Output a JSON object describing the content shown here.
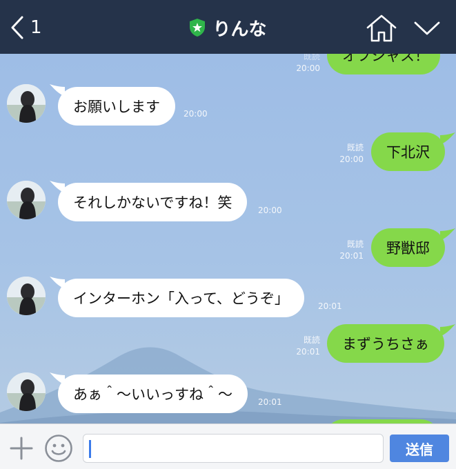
{
  "header": {
    "back_count": "1",
    "title": "りんな"
  },
  "messages": [
    {
      "dir": "out",
      "text": "オフシャス！",
      "read": "既読",
      "time": "20:00"
    },
    {
      "dir": "in",
      "text": "お願いします",
      "time": "20:00"
    },
    {
      "dir": "out",
      "text": "下北沢",
      "read": "既読",
      "time": "20:00"
    },
    {
      "dir": "in",
      "text": "それしかないですね！笑",
      "time": "20:00"
    },
    {
      "dir": "out",
      "text": "野獣邸",
      "read": "既読",
      "time": "20:01"
    },
    {
      "dir": "in",
      "text": "インターホン「入って、どうぞ」",
      "time": "20:01"
    },
    {
      "dir": "out",
      "text": "まずうちさぁ",
      "read": "既読",
      "time": "20:01"
    },
    {
      "dir": "in",
      "text": "あぁ＾〜いいっすね＾〜",
      "time": "20:01"
    }
  ],
  "input": {
    "value": "",
    "send_label": "送信"
  },
  "colors": {
    "header_bg": "#25334a",
    "outgoing_bubble": "#85d84a",
    "incoming_bubble": "#ffffff",
    "send_button": "#4f86e0"
  },
  "icons": [
    "back-chevron-icon",
    "verified-shield-icon",
    "home-icon",
    "chevron-down-icon",
    "plus-icon",
    "smiley-icon"
  ]
}
